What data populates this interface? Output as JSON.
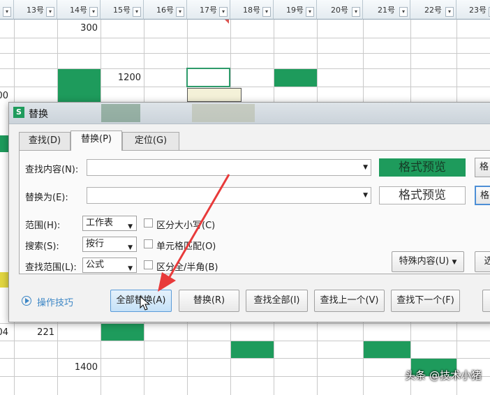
{
  "sheet": {
    "columns": [
      "13号",
      "14号",
      "15号",
      "16号",
      "17号",
      "18号",
      "19号",
      "20号",
      "21号",
      "22号",
      "23号"
    ],
    "cells": {
      "r1_14": "300",
      "r3_15": "1200",
      "r_left_frag_top": "00",
      "r_left_frag_bottom": "04",
      "r_b_13": "221",
      "r_d_14": "1400"
    }
  },
  "dialog": {
    "title": "替换",
    "tabs": [
      "查找(D)",
      "替换(P)",
      "定位(G)"
    ],
    "active_tab": "替换(P)",
    "find_label": "查找内容(N):",
    "find_value": "",
    "replace_label": "替换为(E):",
    "replace_value": "",
    "preview_find": "格式预览",
    "preview_replace": "格式预览",
    "format_btn1": "格",
    "format_btn2": "格",
    "range_label": "范围(H):",
    "range_value": "工作表",
    "search_label": "搜索(S):",
    "search_value": "按行",
    "lookin_label": "查找范围(L):",
    "lookin_value": "公式",
    "chk_case": "区分大小写(C)",
    "chk_cell": "单元格匹配(O)",
    "chk_width": "区分全/半角(B)",
    "special_btn": "特殊内容(U)",
    "options_btn": "选",
    "tips": "操作技巧",
    "btn_replace_all": "全部替换(A)",
    "btn_replace": "替换(R)",
    "btn_find_all": "查找全部(I)",
    "btn_find_prev": "查找上一个(V)",
    "btn_find_next": "查找下一个(F)"
  },
  "watermark": "头条 @技术小猪",
  "colors": {
    "accent_green": "#1e9b5c",
    "arrow_red": "#e83a3a",
    "link_blue": "#3c86c5"
  }
}
